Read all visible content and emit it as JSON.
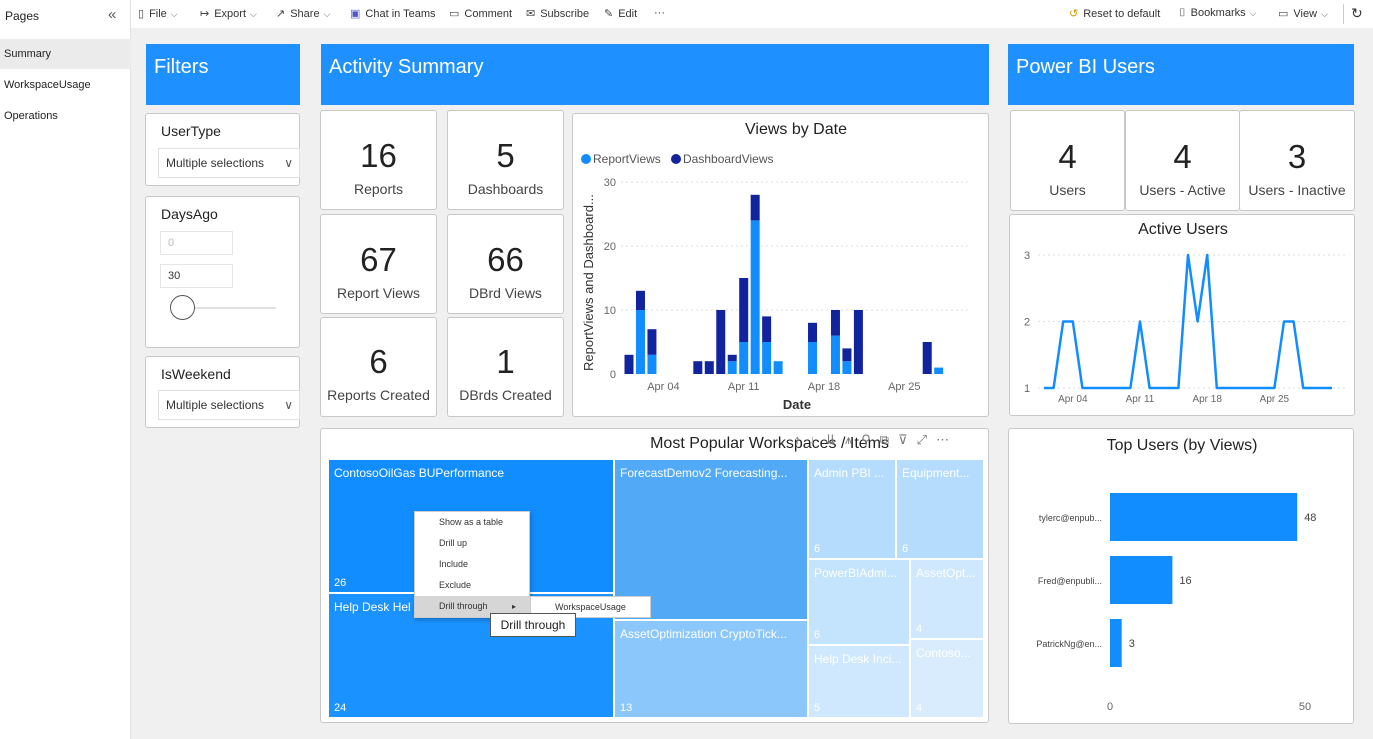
{
  "pages": {
    "title": "Pages",
    "items": [
      {
        "label": "Summary",
        "active": true
      },
      {
        "label": "WorkspaceUsage",
        "active": false
      },
      {
        "label": "Operations",
        "active": false
      }
    ]
  },
  "toolbar": {
    "file": "File",
    "export": "Export",
    "share": "Share",
    "chat": "Chat in Teams",
    "comment": "Comment",
    "subscribe": "Subscribe",
    "edit": "Edit",
    "more": "···",
    "reset": "Reset to default",
    "bookmarks": "Bookmarks",
    "view": "View"
  },
  "headers": {
    "filters": "Filters",
    "activity": "Activity Summary",
    "users": "Power BI Users"
  },
  "filters": {
    "usertype": {
      "title": "UserType",
      "value": "Multiple selections"
    },
    "daysago": {
      "title": "DaysAgo",
      "min": "0",
      "max": "30",
      "slider_fraction": 0
    },
    "isweekend": {
      "title": "IsWeekend",
      "value": "Multiple selections"
    }
  },
  "kpis": {
    "reports": {
      "value": "16",
      "label": "Reports"
    },
    "dashboards": {
      "value": "5",
      "label": "Dashboards"
    },
    "report_views": {
      "value": "67",
      "label": "Report Views"
    },
    "dbrd_views": {
      "value": "66",
      "label": "DBrd Views"
    },
    "reports_created": {
      "value": "6",
      "label": "Reports Created"
    },
    "dbrds_created": {
      "value": "1",
      "label": "DBrds Created"
    },
    "users": {
      "value": "4",
      "label": "Users"
    },
    "users_active": {
      "value": "4",
      "label": "Users - Active"
    },
    "users_inactive": {
      "value": "3",
      "label": "Users - Inactive"
    }
  },
  "colors": {
    "header": "#1e90ff",
    "report_views": "#118dff",
    "dashboard_views": "#12239e"
  },
  "chart_data": [
    {
      "type": "bar",
      "stacked": true,
      "title": "Views by Date",
      "xlabel": "Date",
      "ylabel": "ReportViews and Dashboard...",
      "ylim": [
        0,
        30
      ],
      "yticks": [
        "0",
        "10",
        "20",
        "30"
      ],
      "xticks": [
        "Apr 04",
        "Apr 11",
        "Apr 18",
        "Apr 25"
      ],
      "xtick_days": [
        4,
        11,
        18,
        25
      ],
      "x": [
        1,
        2,
        3,
        4,
        5,
        6,
        7,
        8,
        9,
        10,
        11,
        12,
        13,
        14,
        15,
        16,
        17,
        18,
        19,
        20,
        21,
        22,
        23,
        24,
        25,
        26,
        27,
        28,
        29,
        30,
        31
      ],
      "series": [
        {
          "name": "ReportViews",
          "values": [
            0,
            10,
            3,
            0,
            0,
            0,
            0,
            0,
            0,
            2,
            5,
            24,
            5,
            2,
            0,
            0,
            5,
            0,
            6,
            2,
            0,
            0,
            0,
            0,
            0,
            0,
            0,
            1,
            0,
            0,
            0
          ]
        },
        {
          "name": "DashboardViews",
          "values": [
            3,
            3,
            4,
            0,
            0,
            0,
            2,
            2,
            10,
            1,
            10,
            4,
            4,
            0,
            0,
            0,
            3,
            0,
            4,
            2,
            10,
            0,
            0,
            0,
            0,
            0,
            5,
            0,
            0,
            0,
            0
          ]
        }
      ],
      "legend": "top-left"
    },
    {
      "type": "line",
      "title": "Active Users",
      "ylim": [
        1,
        3
      ],
      "yticks": [
        "1",
        "2",
        "3"
      ],
      "xticks": [
        "Apr 04",
        "Apr 11",
        "Apr 18",
        "Apr 25"
      ],
      "xtick_days": [
        4,
        11,
        18,
        25
      ],
      "x": [
        1,
        2,
        3,
        4,
        5,
        6,
        7,
        8,
        9,
        10,
        11,
        12,
        13,
        14,
        15,
        16,
        17,
        18,
        19,
        20,
        21,
        22,
        23,
        24,
        25,
        26,
        27,
        28,
        29,
        30,
        31
      ],
      "values": [
        1,
        1,
        2,
        2,
        1,
        1,
        1,
        1,
        1,
        1,
        2,
        1,
        1,
        1,
        1,
        3,
        2,
        3,
        1,
        1,
        1,
        1,
        1,
        1,
        1,
        2,
        2,
        1,
        1,
        1,
        1
      ],
      "grid": true
    },
    {
      "type": "bar",
      "orientation": "horizontal",
      "title": "Top Users (by Views)",
      "categories": [
        "tylerc@enpub...",
        "Fred@enpubli...",
        "PatrickNg@en..."
      ],
      "values": [
        48,
        16,
        3
      ],
      "xticks": [
        "0",
        "50"
      ],
      "xlim": [
        0,
        50
      ]
    }
  ],
  "treemap": {
    "title": "Most Popular Workspaces / Items",
    "tiles": [
      {
        "label": "ContosoOilGas BUPerformance",
        "value": "26"
      },
      {
        "label": "Help Desk Hel",
        "value": "24"
      },
      {
        "label": "ForecastDemov2 Forecasting...",
        "value": ""
      },
      {
        "label": "AssetOptimization CryptoTick...",
        "value": "13"
      },
      {
        "label": "Admin PBI ...",
        "value": "6"
      },
      {
        "label": "Equipment...",
        "value": "6"
      },
      {
        "label": "PowerBIAdmi...",
        "value": "6"
      },
      {
        "label": "AssetOpt...",
        "value": "4"
      },
      {
        "label": "Help Desk Inci...",
        "value": "5"
      },
      {
        "label": "Contoso...",
        "value": "4"
      }
    ]
  },
  "context_menu": {
    "items": [
      "Show as a table",
      "Drill up",
      "Include",
      "Exclude",
      "Drill through"
    ],
    "submenu": "WorkspaceUsage",
    "tooltip": "Drill through"
  }
}
